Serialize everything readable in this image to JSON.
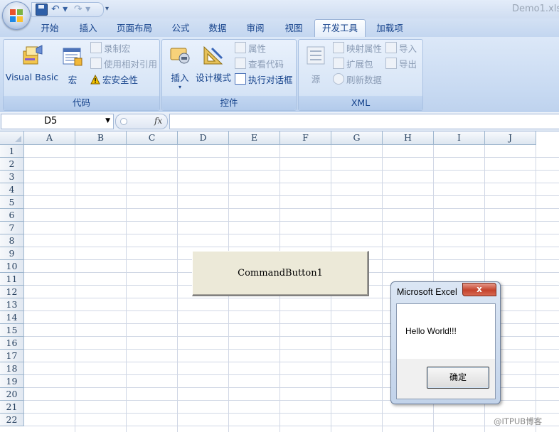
{
  "window": {
    "title": "Demo1.xls"
  },
  "tabs": [
    {
      "label": "开始"
    },
    {
      "label": "插入"
    },
    {
      "label": "页面布局"
    },
    {
      "label": "公式"
    },
    {
      "label": "数据"
    },
    {
      "label": "审阅"
    },
    {
      "label": "视图"
    },
    {
      "label": "开发工具",
      "active": true
    },
    {
      "label": "加载项"
    }
  ],
  "ribbon": {
    "code": {
      "label": "代码",
      "visual_basic": "Visual Basic",
      "macros": "宏",
      "record_macro": "录制宏",
      "relative_ref": "使用相对引用",
      "macro_security": "宏安全性"
    },
    "controls": {
      "label": "控件",
      "insert": "插入",
      "design_mode": "设计模式",
      "properties": "属性",
      "view_code": "查看代码",
      "run_dialog": "执行对话框"
    },
    "xml": {
      "label": "XML",
      "source": "源",
      "map_properties": "映射属性",
      "expansion_packs": "扩展包",
      "refresh_data": "刷新数据",
      "import": "导入",
      "export": "导出"
    }
  },
  "formula_bar": {
    "name_box": "D5",
    "fx": "fx",
    "formula": ""
  },
  "sheet": {
    "columns": [
      "A",
      "B",
      "C",
      "D",
      "E",
      "F",
      "G",
      "H",
      "I",
      "J"
    ],
    "rows": [
      "1",
      "2",
      "3",
      "4",
      "5",
      "6",
      "7",
      "8",
      "9",
      "10",
      "11",
      "12",
      "13",
      "14",
      "15",
      "16",
      "17",
      "18",
      "19",
      "20",
      "21",
      "22"
    ]
  },
  "command_button": {
    "caption": "CommandButton1"
  },
  "msgbox": {
    "title": "Microsoft Excel",
    "close": "x",
    "message": "Hello World!!!",
    "ok": "确定"
  },
  "watermark": "@ITPUB博客",
  "colors": {
    "ribbon_text": "#15428b",
    "grid_line": "#d0d7e5"
  }
}
